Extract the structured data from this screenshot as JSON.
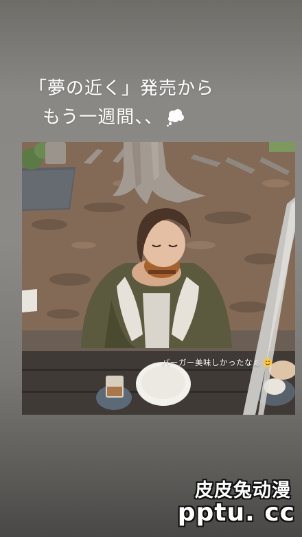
{
  "story": {
    "caption_line1": "「夢の近く」発売から",
    "caption_line2": "もう一週間、、",
    "caption_icon": "thought-bubble-icon",
    "photo_overlay_text": "バーガー美味しかったなぁ",
    "overlay_emoji": "smiling-face-icon"
  },
  "watermark": {
    "site_name": "皮皮兔动漫",
    "site_url": "pptu. cc"
  },
  "colors": {
    "background_top": "#6f6d68",
    "background_bottom": "#4a4846",
    "text": "#ffffff"
  }
}
